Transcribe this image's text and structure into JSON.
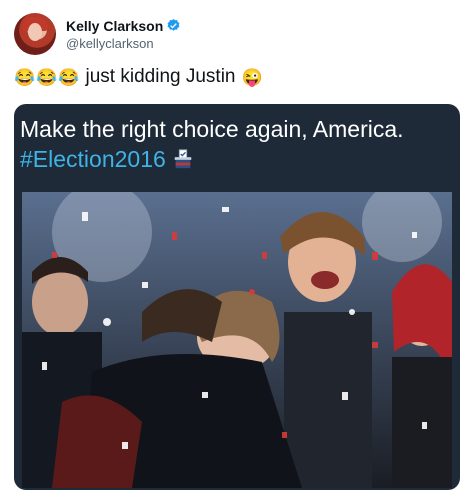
{
  "user": {
    "name": "Kelly Clarkson",
    "handle": "@kellyclarkson",
    "verified": true
  },
  "tweet": {
    "emojis_lead": [
      "😂",
      "😂",
      "😂"
    ],
    "text": "just kidding Justin",
    "emoji_trail": "😜"
  },
  "media": {
    "caption_line1": "Make the right choice again, America.",
    "hashtag": "#Election2016",
    "hashtag_icon": "ballot-box-icon",
    "photo_subject": "celebration-photo"
  },
  "colors": {
    "verified_blue": "#1d9bf0",
    "hashtag_blue": "#3fb3e6",
    "media_bg": "#1e2a38"
  }
}
